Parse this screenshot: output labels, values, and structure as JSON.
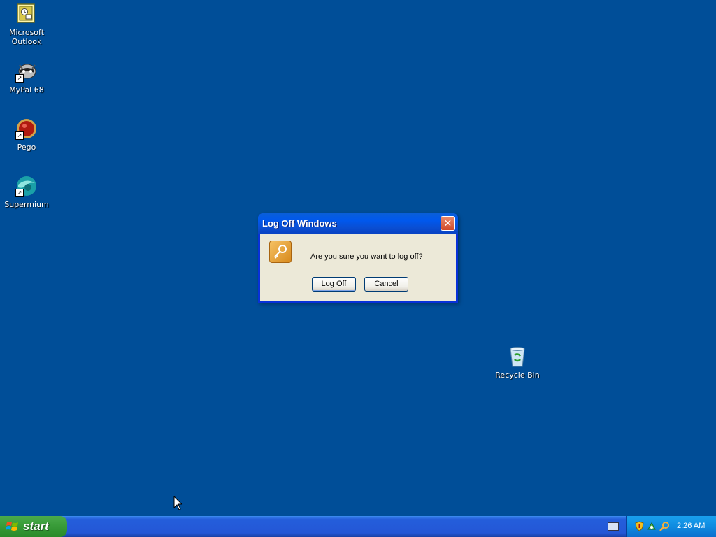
{
  "desktop": {
    "background_color": "#004e98",
    "icons": [
      {
        "label": "Microsoft Outlook",
        "icon": "outlook-icon"
      },
      {
        "label": "MyPal 68",
        "icon": "mypal-icon"
      },
      {
        "label": "Pego",
        "icon": "pego-icon"
      },
      {
        "label": "Supermium",
        "icon": "supermium-icon"
      },
      {
        "label": "Recycle Bin",
        "icon": "recycle-bin-icon"
      }
    ]
  },
  "dialog": {
    "title": "Log Off Windows",
    "message": "Are you sure you want to log off?",
    "log_off_label": "Log Off",
    "cancel_label": "Cancel",
    "icon": "key-icon"
  },
  "taskbar": {
    "start_label": "start",
    "clock": "2:26 AM",
    "tray_icons": [
      "security-shield-icon",
      "network-icon",
      "search-icon"
    ]
  }
}
